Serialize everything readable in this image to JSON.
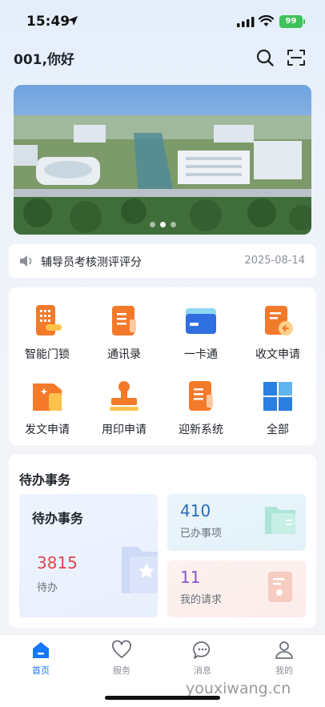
{
  "status": {
    "time": "15:49",
    "battery": "99"
  },
  "header": {
    "greeting": "001,你好"
  },
  "notice": {
    "text": "辅导员考核测评评分",
    "date": "2025-08-14"
  },
  "apps": [
    {
      "label": "智能门锁",
      "icon": "smart-lock-icon"
    },
    {
      "label": "通讯录",
      "icon": "contacts-icon"
    },
    {
      "label": "一卡通",
      "icon": "campus-card-icon"
    },
    {
      "label": "收文申请",
      "icon": "receive-document-icon"
    },
    {
      "label": "发文申请",
      "icon": "send-document-icon"
    },
    {
      "label": "用印申请",
      "icon": "seal-icon"
    },
    {
      "label": "迎新系统",
      "icon": "freshman-system-icon"
    },
    {
      "label": "全部",
      "icon": "all-apps-icon"
    }
  ],
  "todo": {
    "title": "待办事务",
    "pending": {
      "title": "待办事务",
      "count": "3815",
      "label": "待办"
    },
    "done": {
      "count": "410",
      "label": "已办事项"
    },
    "requests": {
      "count": "11",
      "label": "我的请求"
    }
  },
  "tabs": [
    {
      "label": "首页",
      "icon": "home-icon",
      "active": true
    },
    {
      "label": "服务",
      "icon": "service-heart-icon",
      "active": false
    },
    {
      "label": "消息",
      "icon": "message-icon",
      "active": false
    },
    {
      "label": "我的",
      "icon": "profile-icon",
      "active": false
    }
  ],
  "colors": {
    "accent": "#1677ff",
    "pending": "#e0454f",
    "done": "#2a6cb8",
    "requests": "#8a55c9",
    "app_orange": "#f07a2a"
  },
  "watermark": "youxiwang.cn"
}
